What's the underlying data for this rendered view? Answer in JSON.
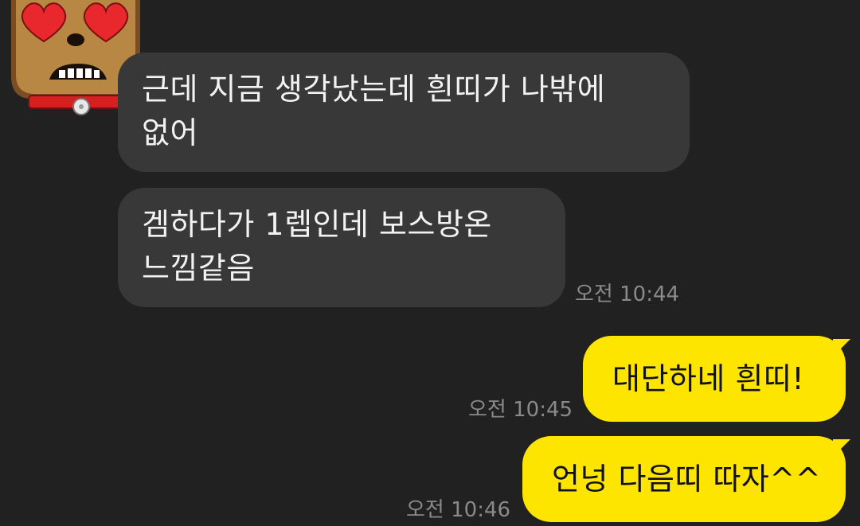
{
  "messages": [
    {
      "side": "incoming",
      "lines": [
        "근데 지금 생각났는데 흰띠가 나밖에",
        "없어"
      ]
    },
    {
      "side": "incoming",
      "lines": [
        "겜하다가 1렙인데 보스방온",
        "느낌같음"
      ],
      "time": "오전 10:44"
    },
    {
      "side": "outgoing",
      "text": "대단하네 흰띠!",
      "time": "오전 10:45"
    },
    {
      "side": "outgoing",
      "text": "언넝 다음띠 따자^^",
      "time": "오전 10:46"
    }
  ],
  "colors": {
    "background": "#212121",
    "incoming_bubble": "#383838",
    "outgoing_bubble": "#fee500",
    "timestamp": "#8a8a8a"
  },
  "avatar": {
    "icon": "heart-eyes-dog-emoticon-icon"
  }
}
